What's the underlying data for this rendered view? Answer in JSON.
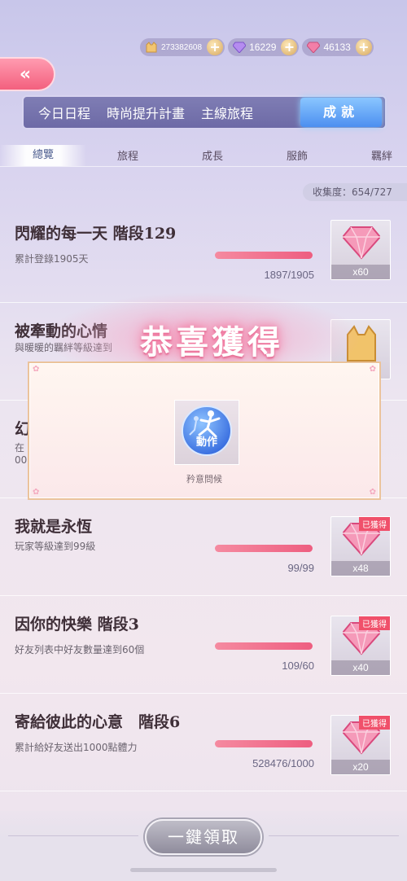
{
  "currency": {
    "coins": "273382608",
    "purple_diamonds": "16229",
    "pink_diamonds": "46133"
  },
  "back_icon": "double-chevron-left-icon",
  "main_tabs": [
    "今日日程",
    "時尚提升計畫",
    "主線旅程",
    "成就"
  ],
  "active_main_tab": "成就",
  "sub_tabs": [
    "總覽",
    "旅程",
    "成長",
    "服飾",
    "羈絆"
  ],
  "active_sub_tab": "總覽",
  "collection": "收集度：654/727",
  "achievements": [
    {
      "title": "閃耀的每一天 階段129",
      "desc": "累計登錄1905天",
      "progress": "1897/1905",
      "progress_value": 0.996,
      "reward_qty": "x60",
      "reward_icon": "pink-diamond-icon",
      "obtained": false
    },
    {
      "title": "被牽動的心情",
      "desc": "與暖暖的羈絆等級達到",
      "progress": "",
      "progress_value": 1.0,
      "reward_qty": "",
      "reward_icon": "gold-cat-icon",
      "obtained": false
    },
    {
      "title": "幻",
      "desc": "在",
      "progress": "00",
      "progress_value": 1.0,
      "reward_qty": "",
      "reward_icon": "",
      "obtained": false
    },
    {
      "title": "我就是永恆",
      "desc": "玩家等級達到99級",
      "progress": "99/99",
      "progress_value": 1.0,
      "reward_qty": "x48",
      "reward_icon": "pink-diamond-icon",
      "obtained": true
    },
    {
      "title": "因你的快樂 階段3",
      "desc": "好友列表中好友數量達到60個",
      "progress": "109/60",
      "progress_value": 1.0,
      "reward_qty": "x40",
      "reward_icon": "pink-diamond-icon",
      "obtained": true
    },
    {
      "title": "寄給彼此的心意　階段6",
      "desc": "累計給好友送出1000點體力",
      "progress": "528476/1000",
      "progress_value": 1.0,
      "reward_qty": "x20",
      "reward_icon": "pink-diamond-icon",
      "obtained": true
    }
  ],
  "obtained_label": "已獲得",
  "popup": {
    "title": "恭喜獲得",
    "item_label": "動作",
    "item_name": "矜意問候",
    "item_icon": "motion-action-icon"
  },
  "claim_all": "一鍵領取",
  "colors": {
    "accent_pink": "#ee5e80",
    "active_tab_blue": "#4c8ff0",
    "badge_red": "#f0506a"
  }
}
